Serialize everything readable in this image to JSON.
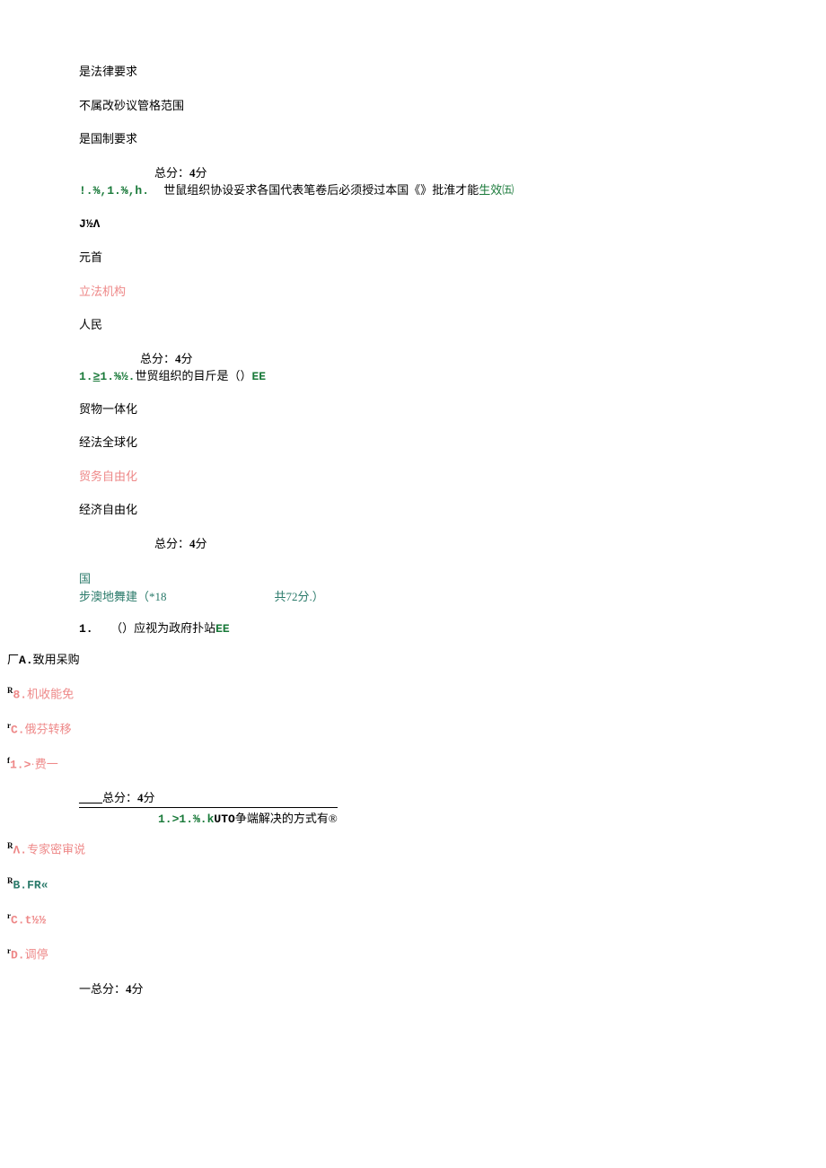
{
  "q1": {
    "opt_a": "是法律要求",
    "opt_b": "不属改砂议管格范围",
    "opt_c": "是国制要求",
    "score": "总分：",
    "score_val": "4",
    "score_suffix": "分"
  },
  "q2": {
    "num_prefix": "!.⅜,1.⅜,h.",
    "stem_a": "世鼠组织协设妥求各国代表笔卷后必须授过本国《》批淮才能",
    "stem_b": "生效㈤",
    "code": "J½Λ",
    "opt_a": "元首",
    "opt_b": "立法机构",
    "opt_c": "人民",
    "score": "总分：",
    "score_val": "4",
    "score_suffix": "分"
  },
  "q3": {
    "num_prefix_a": "1.",
    "num_prefix_b": "≥",
    "num_prefix_c": "1.⅜½.",
    "stem": "世贸组织的目斤是（）",
    "stem_suffix": "EE",
    "opt_a": "贸物一体化",
    "opt_b": "经法全球化",
    "opt_c": "贸务自由化",
    "opt_d": "经济自由化",
    "score": "总分：",
    "score_val": "4",
    "score_suffix": "分"
  },
  "section": {
    "line1": "国",
    "line2_a": "步澳地舞建（*18",
    "line2_b": "共72分.）"
  },
  "q4": {
    "num": "1.",
    "stem_a": "（）应视为政府扑站",
    "stem_b": "EE",
    "opt_a_pre": "厂",
    "opt_a_label": "A.",
    "opt_a_text": "致用呆购",
    "opt_b_sup": "R",
    "opt_b_label": "8.",
    "opt_b_text": "机收能免",
    "opt_c_sup": "r",
    "opt_c_label": "C.",
    "opt_c_text": "俄芬转移",
    "opt_d_sup": "f",
    "opt_d_label": "1.>",
    "opt_d_text": "·费一",
    "score_pre": "____",
    "score": "总分：",
    "score_val": "4",
    "score_suffix": "分"
  },
  "q5": {
    "num_prefix": "1.>1.⅜.k",
    "stem_a": "UTO",
    "stem_b": "争端解决的方式有®",
    "opt_a_sup": "R",
    "opt_a_label": "Λ.",
    "opt_a_text": "专家密审说",
    "opt_b_sup": "R",
    "opt_b_label": "B.FR«",
    "opt_c_sup": "r",
    "opt_c_label": "C.",
    "opt_c_text": "t½½",
    "opt_d_sup": "r",
    "opt_d_label": "D.",
    "opt_d_text": "调停",
    "score_pre": "一",
    "score": "总分：",
    "score_val": "4",
    "score_suffix": "分"
  }
}
